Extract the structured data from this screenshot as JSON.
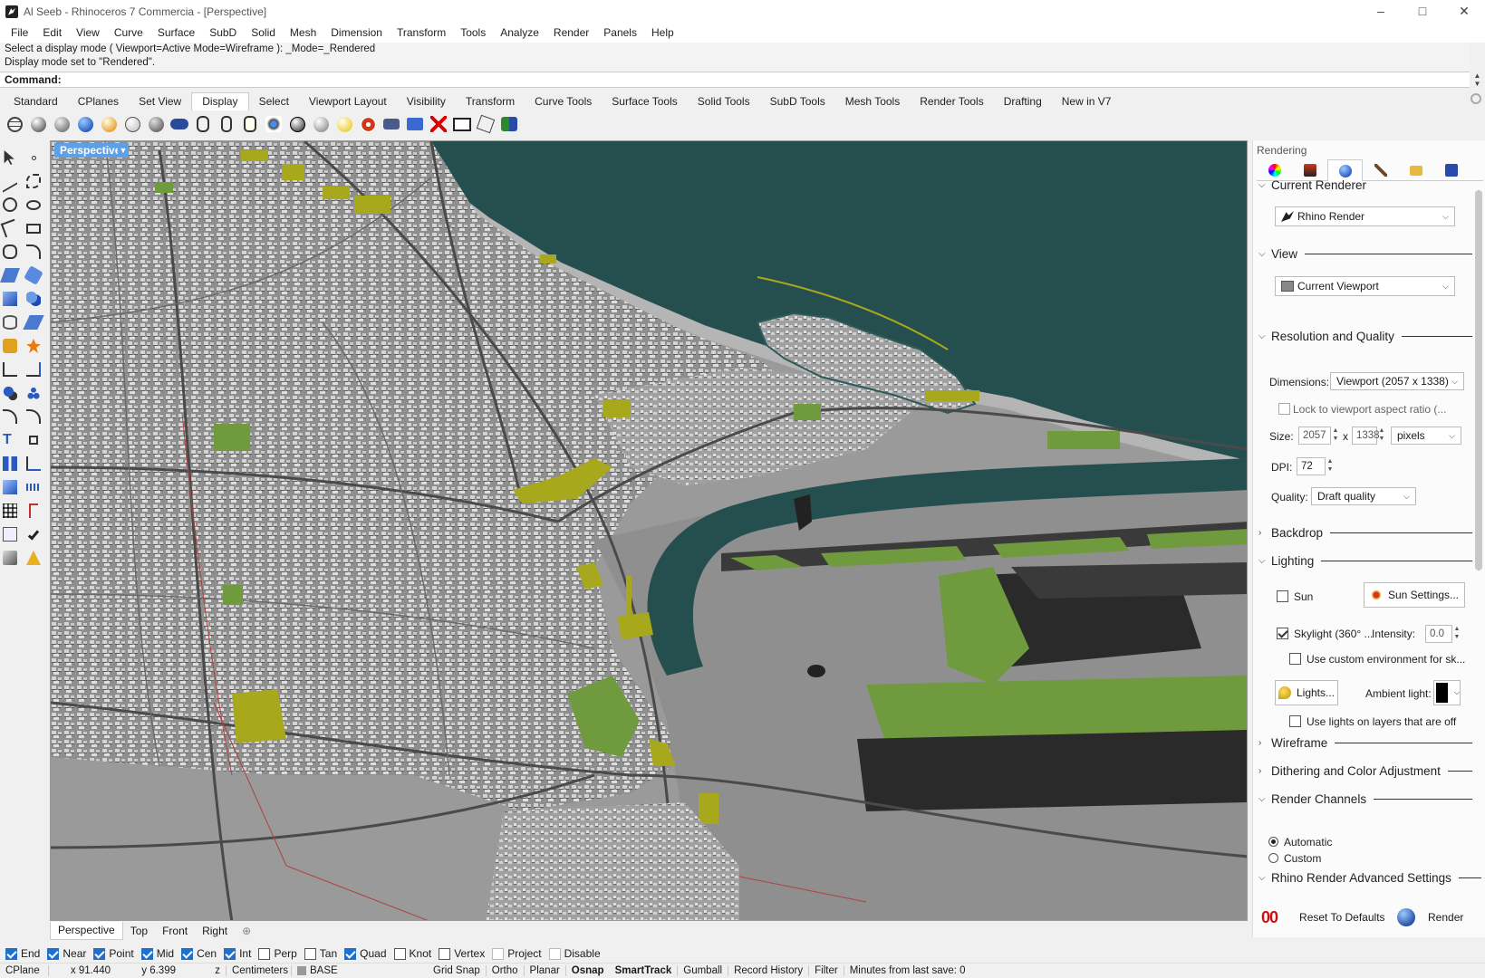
{
  "window": {
    "title": "Al Seeb - Rhinoceros 7 Commercia - [Perspective]",
    "controls": [
      "minimize-icon",
      "maximize-icon",
      "close-icon"
    ]
  },
  "menu": [
    "File",
    "Edit",
    "View",
    "Curve",
    "Surface",
    "SubD",
    "Solid",
    "Mesh",
    "Dimension",
    "Transform",
    "Tools",
    "Analyze",
    "Render",
    "Panels",
    "Help"
  ],
  "command_history": [
    "Select a display mode ( Viewport=Active  Mode=Wireframe ): _Mode=_Rendered",
    "Display mode set to \"Rendered\"."
  ],
  "command_prompt": "Command:",
  "toolbar_tabs": [
    "Standard",
    "CPlanes",
    "Set View",
    "Display",
    "Select",
    "Viewport Layout",
    "Visibility",
    "Transform",
    "Curve Tools",
    "Surface Tools",
    "Solid Tools",
    "SubD Tools",
    "Mesh Tools",
    "Render Tools",
    "Drafting",
    "New in V7"
  ],
  "active_toolbar_tab": "Display",
  "viewport": {
    "label": "Perspective",
    "colors": {
      "sea": "#254f4f",
      "land": "#9a9a9a",
      "green": "#6f9a3e",
      "olive": "#a8a81c",
      "tarmac": "#2a2a2a"
    }
  },
  "viewport_tabs": [
    "Perspective",
    "Top",
    "Front",
    "Right"
  ],
  "osnaps": [
    {
      "label": "End",
      "checked": true
    },
    {
      "label": "Near",
      "checked": true
    },
    {
      "label": "Point",
      "checked": true
    },
    {
      "label": "Mid",
      "checked": true
    },
    {
      "label": "Cen",
      "checked": true
    },
    {
      "label": "Int",
      "checked": true
    },
    {
      "label": "Perp",
      "checked": false
    },
    {
      "label": "Tan",
      "checked": false
    },
    {
      "label": "Quad",
      "checked": true
    },
    {
      "label": "Knot",
      "checked": false
    },
    {
      "label": "Vertex",
      "checked": false
    },
    {
      "label": "Project",
      "checked": false
    },
    {
      "label": "Disable",
      "checked": false
    }
  ],
  "status": {
    "cplane": "CPlane",
    "x": "x 91.440",
    "y": "y 6.399",
    "z": "z",
    "units": "Centimeters",
    "layer": "BASE",
    "grid_snap": "Grid Snap",
    "ortho": "Ortho",
    "planar": "Planar",
    "osnap": "Osnap",
    "smarttrack": "SmartTrack",
    "gumball": "Gumball",
    "record_history": "Record History",
    "filter": "Filter",
    "save_info": "Minutes from last save: 0"
  },
  "panel": {
    "title": "Rendering",
    "sections": {
      "current_renderer": "Current Renderer",
      "view": "View",
      "resolution": "Resolution and Quality",
      "backdrop": "Backdrop",
      "lighting": "Lighting",
      "wireframe": "Wireframe",
      "dithering": "Dithering and Color Adjustment",
      "render_channels": "Render Channels",
      "advanced": "Rhino Render Advanced Settings"
    },
    "renderer": "Rhino Render",
    "view_value": "Current Viewport",
    "dimensions_label": "Dimensions:",
    "dimensions_value": "Viewport (2057 x 1338)",
    "lock_aspect": "Lock to viewport aspect ratio (...",
    "size_label": "Size:",
    "size_w": "2057",
    "size_x": "x",
    "size_h": "1338",
    "size_unit": "pixels",
    "dpi_label": "DPI:",
    "dpi_value": "72",
    "quality_label": "Quality:",
    "quality_value": "Draft quality",
    "sun_label": "Sun",
    "sun_settings": "Sun Settings...",
    "skylight_label": "Skylight (360° ...",
    "intensity_label": "Intensity:",
    "intensity_value": "0.0",
    "custom_env": "Use custom environment for sk...",
    "lights_button": "Lights...",
    "ambient_label": "Ambient light:",
    "ambient_color": "#000000",
    "lights_on_layers": "Use lights on layers that are off",
    "channel_automatic": "Automatic",
    "channel_custom": "Custom",
    "reset_button": "Reset To Defaults",
    "render_button": "Render"
  }
}
